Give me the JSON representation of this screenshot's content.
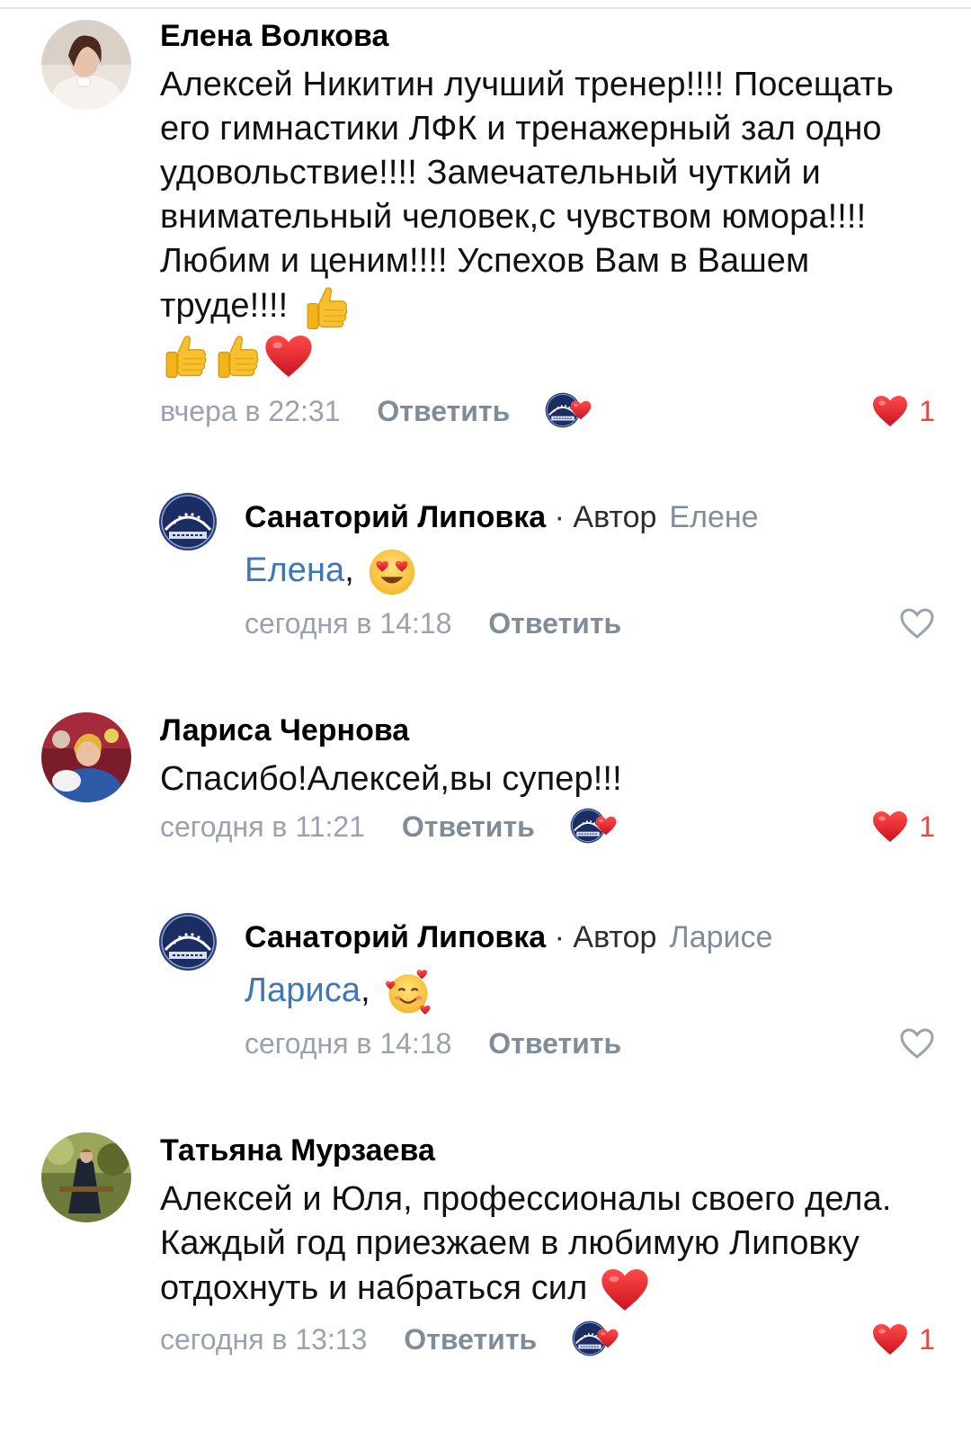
{
  "colors": {
    "accent_link": "#3f76b8",
    "like_red": "#e64646",
    "secondary_text": "#818c99"
  },
  "comments": [
    {
      "author": "Елена Волкова",
      "text": "Алексей Никитин лучший тренер!!!! Посещать его гимнастики ЛФК и тренажерный зал одно удовольствие!!!! Замечательный чуткий и внимательный человек,с чувством юмора!!!! Любим и ценим!!!! Успехов Вам в Вашем труде!!!!",
      "emojis": [
        "thumbs-up",
        "thumbs-up",
        "thumbs-up",
        "red-heart"
      ],
      "time": "вчера в 22:31",
      "reply_label": "Ответить",
      "likes": "1",
      "liked_by_author": true,
      "reply": {
        "author": "Санаторий Липовка",
        "role": " · Автор",
        "reply_to": "Елене",
        "mention": "Елена",
        "text_after": ",",
        "emoji": "heart-eyes",
        "time": "сегодня в 14:18",
        "reply_label": "Ответить"
      }
    },
    {
      "author": "Лариса Чернова",
      "text": "Спасибо!Алексей,вы супер!!!",
      "time": "сегодня в 11:21",
      "reply_label": "Ответить",
      "likes": "1",
      "liked_by_author": true,
      "reply": {
        "author": "Санаторий Липовка",
        "role": " · Автор",
        "reply_to": "Ларисе",
        "mention": "Лариса",
        "text_after": ",",
        "emoji": "smiling-face-with-hearts",
        "time": "сегодня в 14:18",
        "reply_label": "Ответить"
      }
    },
    {
      "author": "Татьяна Мурзаева",
      "text": "Алексей и Юля, профессионалы своего дела. Каждый год приезжаем в любимую Липовку отдохнуть и набраться сил",
      "emojis": [
        "red-heart"
      ],
      "time": "сегодня в 13:13",
      "reply_label": "Ответить",
      "likes": "1",
      "liked_by_author": true
    }
  ]
}
